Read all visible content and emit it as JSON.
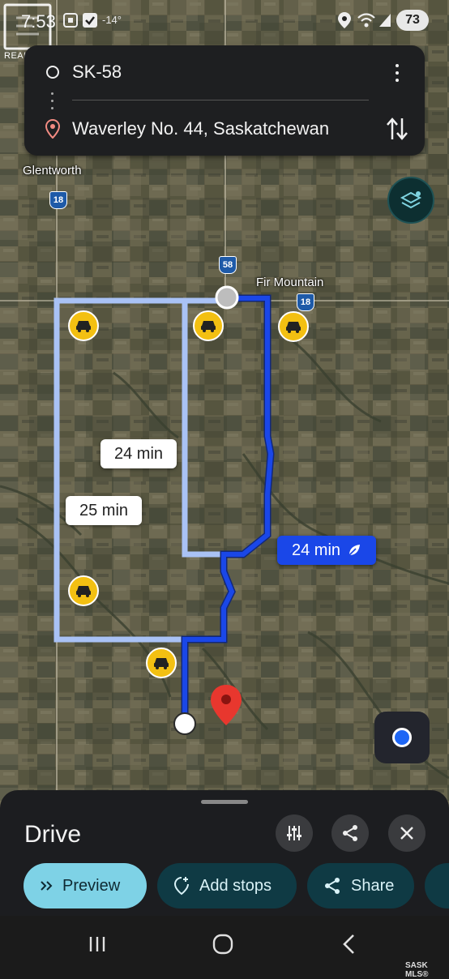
{
  "status_bar": {
    "time": "7:53",
    "temperature": "-14°",
    "battery": "73",
    "icons": [
      "screenshot-icon",
      "check-icon",
      "location-icon",
      "wifi-icon",
      "signal-icon"
    ]
  },
  "watermark": {
    "realtor": "REALTOR®",
    "mls": "SASK MLS®"
  },
  "directions": {
    "origin": "SK-58",
    "destination": "Waverley No. 44, Saskatchewan"
  },
  "map": {
    "places": {
      "glentworth": "Glentworth",
      "fir_mountain": "Fir Mountain"
    },
    "highways": {
      "hwy18_west": "18",
      "hwy58": "58",
      "hwy18_east": "18"
    },
    "routes": {
      "alt_route_1": "24 min",
      "alt_route_2": "25 min",
      "main_route": "24 min"
    },
    "colors": {
      "main_route": "#1a47e8",
      "alt_route": "#a9c2f5",
      "hazard": "#f3c012",
      "destination_pin": "#e8372e"
    }
  },
  "sheet": {
    "title": "Drive",
    "buttons": {
      "preview": "Preview",
      "add_stops": "Add stops",
      "share": "Share"
    }
  }
}
